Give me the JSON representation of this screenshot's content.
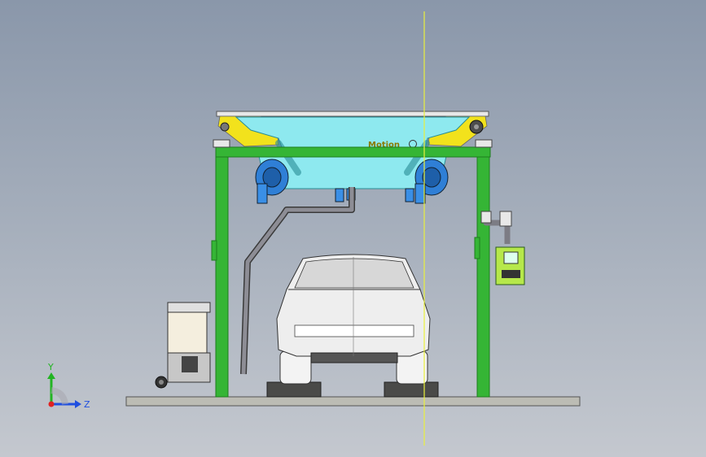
{
  "scene": {
    "brand_text": "Motion",
    "axes": {
      "y_label": "Y",
      "z_label": "Z"
    }
  },
  "colors": {
    "frame": "#35b535",
    "frame_dark": "#1d7d1d",
    "gantry": "#8ee9ef",
    "gantry_dark": "#3aaab5",
    "rail_yellow": "#f2e21c",
    "brush": "#2f7fd6",
    "pipe": "#7c7c84",
    "base": "#bcbcb4",
    "car_body": "#e6e6e6",
    "ref_line": "#e9f03d",
    "panel": "#b6e84a",
    "axis_y": "#22b422",
    "axis_z": "#1f4fe0",
    "axis_x": "#e02222"
  }
}
